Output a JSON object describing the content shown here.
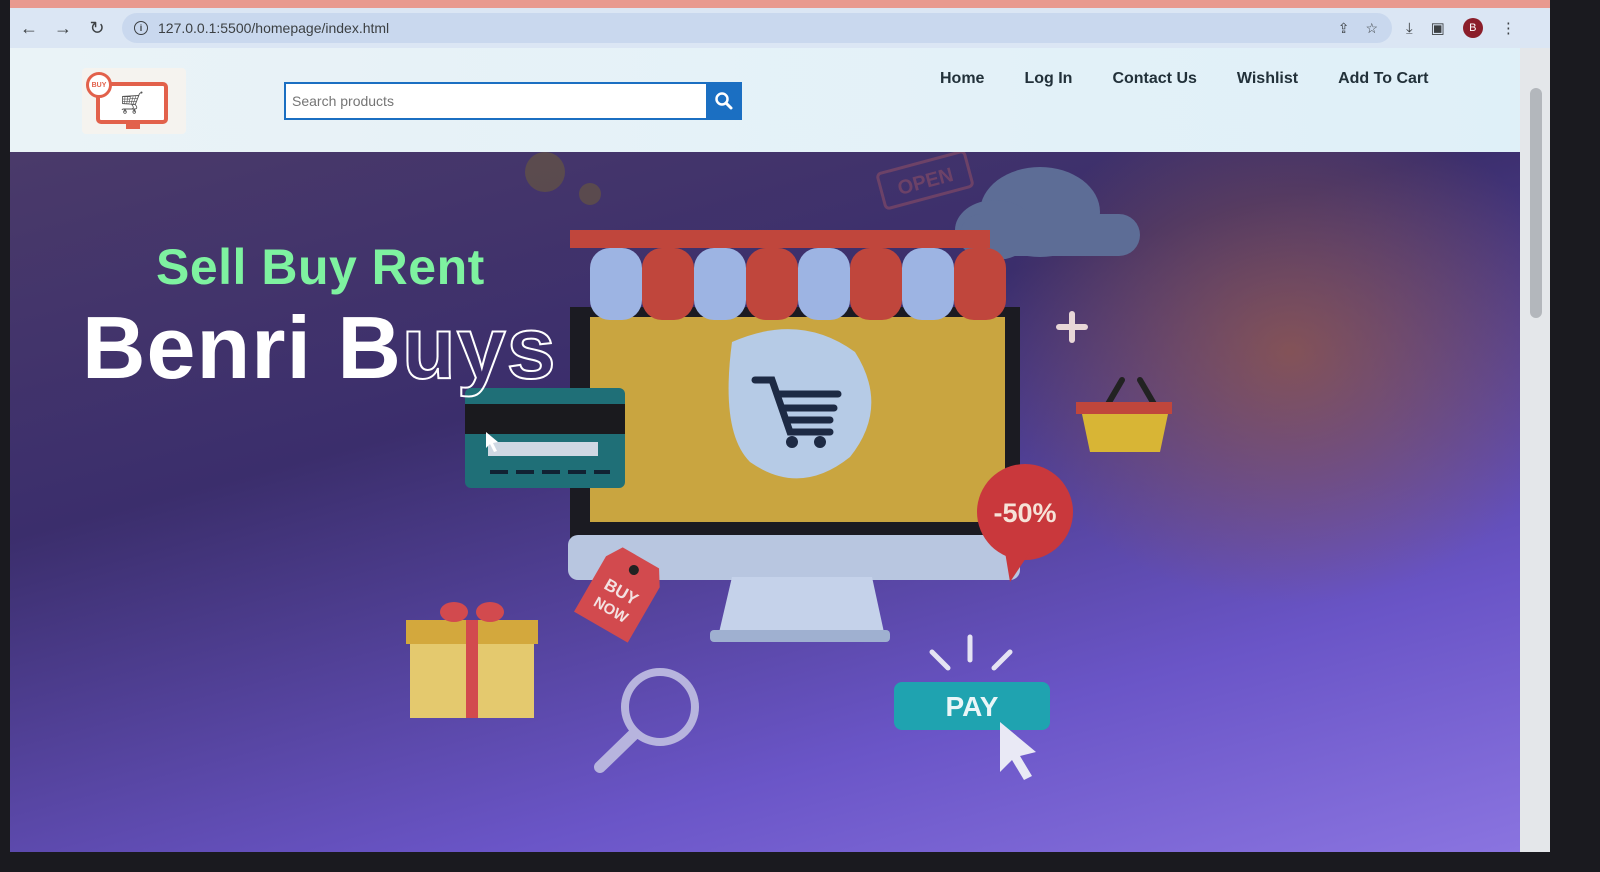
{
  "browser": {
    "url": "127.0.0.1:5500/homepage/index.html"
  },
  "header": {
    "logo_badge": "BUY",
    "search_placeholder": "Search products",
    "nav": [
      "Home",
      "Log In",
      "Contact Us",
      "Wishlist",
      "Add To Cart"
    ]
  },
  "hero": {
    "tagline": "Sell Buy Rent",
    "brand_solid": "Benri B",
    "brand_outline": "uys",
    "discount_tag": "-50%",
    "buy_tag_line1": "BUY",
    "buy_tag_line2": "NOW",
    "pay_button": "PAY",
    "shop_sign": "OPEN"
  },
  "colors": {
    "accent": "#1b6fc2",
    "tagline": "#7ef2a0",
    "logo": "#e2614b"
  },
  "icons": [
    "back-icon",
    "forward-icon",
    "reload-icon",
    "info-icon",
    "share-icon",
    "star-icon",
    "download-icon",
    "sidepanel-icon",
    "menu-icon",
    "search-icon"
  ]
}
